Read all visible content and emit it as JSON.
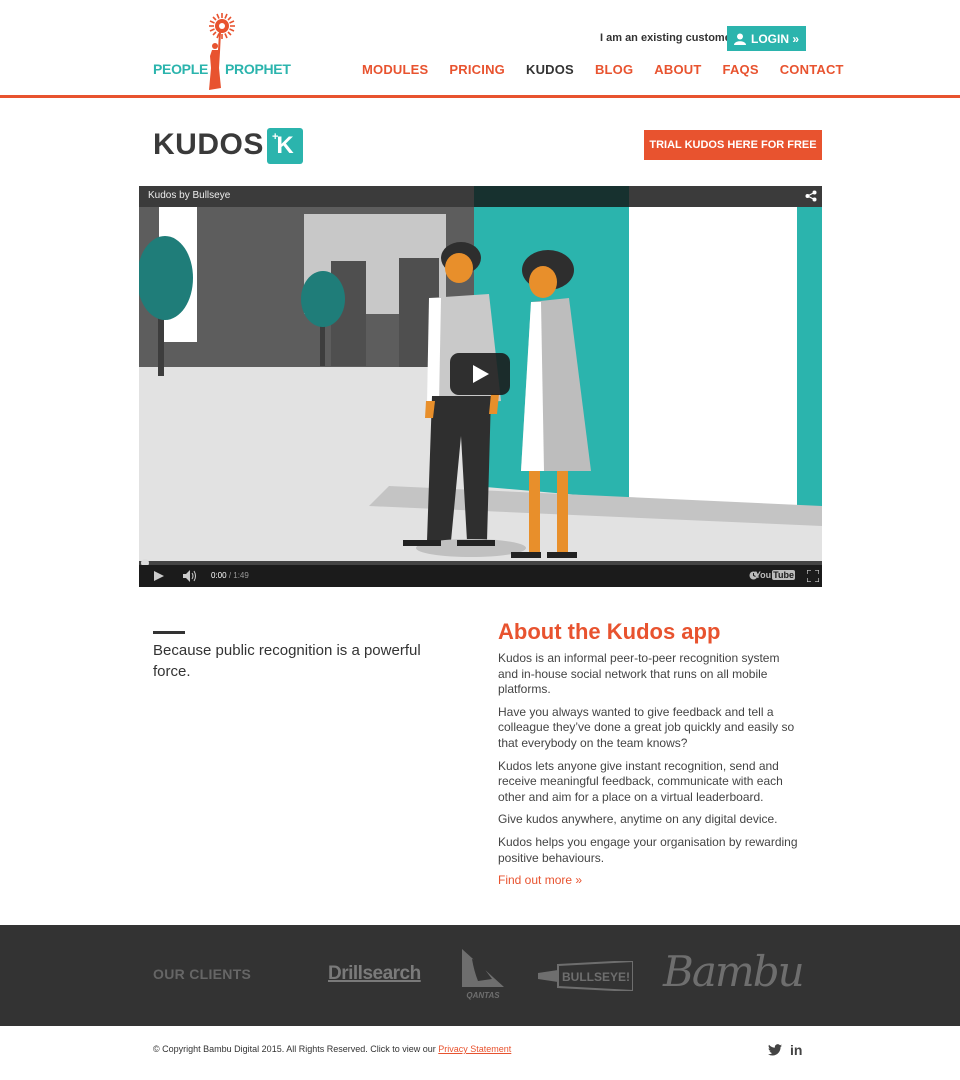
{
  "header": {
    "logo": {
      "left": "PEOPLE",
      "right": "PROPHET"
    },
    "existing_customer": "I am an existing customer",
    "login_label": "LOGIN »",
    "nav": [
      {
        "label": "MODULES",
        "active": false
      },
      {
        "label": "PRICING",
        "active": false
      },
      {
        "label": "KUDOS",
        "active": true
      },
      {
        "label": "BLOG",
        "active": false
      },
      {
        "label": "ABOUT",
        "active": false
      },
      {
        "label": "FAQS",
        "active": false
      },
      {
        "label": "CONTACT",
        "active": false
      }
    ]
  },
  "title": {
    "text": "KUDOS",
    "badge": "K",
    "badge_sup": "+",
    "trial_button": "TRIAL KUDOS HERE FOR FREE"
  },
  "video": {
    "title": "Kudos by Bullseye",
    "time_current": "0:00",
    "time_total": "/ 1:49",
    "provider": "You",
    "provider_tube": "Tube"
  },
  "content": {
    "tagline": "Because public recognition is a powerful force.",
    "about_title": "About the Kudos app",
    "paragraphs": [
      "Kudos is an informal peer-to-peer recognition system and in-house social network that runs on all mobile platforms.",
      "Have you always wanted to give feedback and tell a colleague they’ve done a great job quickly and easily so that everybody on the team knows?",
      "Kudos lets anyone give instant recognition, send and receive meaningful feedback, communicate with each other and aim for a place on a virtual leaderboard.",
      "Give kudos anywhere, anytime on any digital device.",
      "Kudos helps you engage your organisation by rewarding positive behaviours."
    ],
    "find_more": "Find out more »"
  },
  "clients": {
    "title": "OUR CLIENTS",
    "logos": [
      "Drillsearch",
      "QANTAS",
      "BULLSEYE!",
      "Bambu"
    ]
  },
  "footer": {
    "copyright": "© Copyright Bambu Digital 2015. All Rights Reserved. Click to view our",
    "privacy": "Privacy Statement",
    "twitter": "t",
    "linkedin": "in"
  },
  "colors": {
    "accent": "#e8532f",
    "teal": "#2bb4ad",
    "dark": "#333333"
  }
}
